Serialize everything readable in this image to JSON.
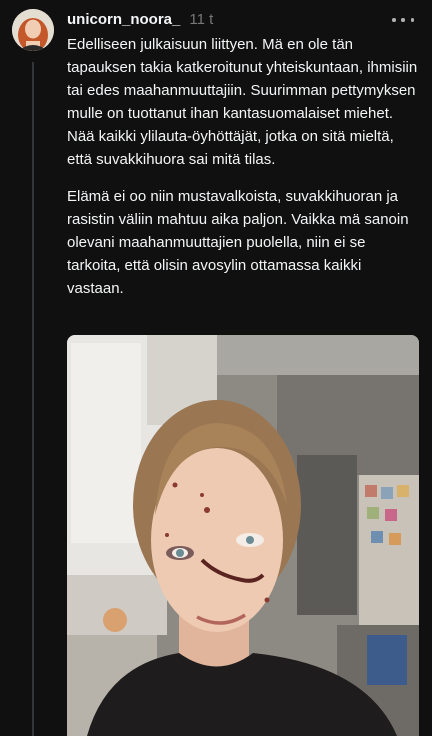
{
  "post": {
    "username": "unicorn_noora_",
    "timestamp": "11 t",
    "paragraphs": [
      "Edelliseen julkaisuun liittyen. Mä en ole tän tapauksen takia katkeroitunut yhteiskuntaan, ihmisiin tai edes maahanmuuttajiin. Suurimman pettymyksen mulle on tuottanut ihan kantasuomalaiset miehet. Nää kaikki ylilauta-öyhöttäjät, jotka on sitä mieltä, että suvakkihuora sai mitä tilas.",
      "Elämä ei oo niin mustavalkoista, suvakkihuoran ja rasistin väliin mahtuu aika paljon. Vaikka mä sanoin olevani maahanmuuttajien puolella, niin ei se tarkoita, että olisin avosylin ottamassa kaikki vastaan."
    ],
    "avatar_icon": "profile-photo",
    "more_icon": "more-horizontal-icon",
    "colors": {
      "background": "#101010",
      "text": "#f3f5f7",
      "secondary_text": "#777777",
      "thread_line": "#333638"
    }
  }
}
